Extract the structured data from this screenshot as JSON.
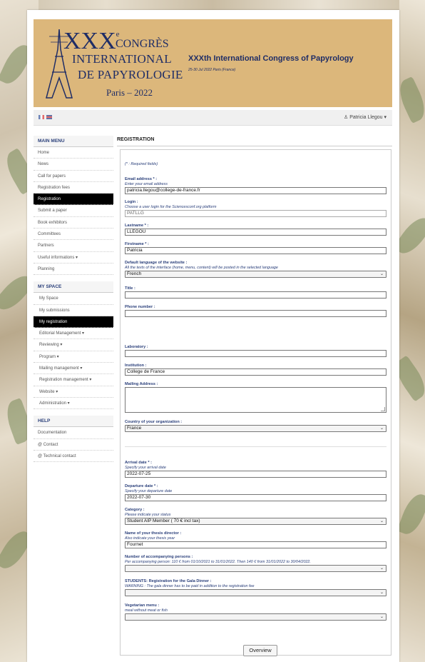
{
  "banner": {
    "logo_xxx": "XXX",
    "logo_sup": "e",
    "logo_congres": "CONGRÈS",
    "logo_international": "INTERNATIONAL",
    "logo_papyrologie": "DE PAPYROLOGIE",
    "logo_paris": "Paris – 2022",
    "title": "XXXth International Congress of Papyrology",
    "dates": "25-30 Jul 2022 Paris (France)"
  },
  "userbar": {
    "user_name": "Patricia Llegou",
    "user_icon": "user-icon"
  },
  "sidebar": {
    "main_menu_title": "MAIN MENU",
    "main_menu": [
      "Home",
      "News",
      "Call for papers",
      "Registration fees",
      "Registration",
      "Submit a paper",
      "Book exhibitors",
      "Committees",
      "Partners",
      "Useful informations ▾",
      "Planning"
    ],
    "main_menu_active": 4,
    "my_space_title": "MY SPACE",
    "my_space": [
      "My Space",
      "My submissions",
      "My registration",
      "Editorial Management ▾",
      "Reviewing ▾",
      "Program ▾",
      "Mailing management ▾",
      "Registration management ▾",
      "Website ▾",
      "Administration ▾"
    ],
    "my_space_active": 2,
    "help_title": "HELP",
    "help": [
      "Documentation",
      "@ Contact",
      "@ Technical contact"
    ]
  },
  "content": {
    "title": "REGISTRATION",
    "required_note": "(* : Required fields)",
    "email": {
      "label": "Email address * :",
      "hint": "Enter your email address",
      "value": "patricia.llegou@college-de-france.fr"
    },
    "login": {
      "label": "Login :",
      "hint": "Choose a user login for the Sciencesconf.org platform",
      "value": "PATLLG"
    },
    "lastname": {
      "label": "Lastname * :",
      "value": "LLEGOU"
    },
    "firstname": {
      "label": "Firstname * :",
      "value": "Patricia"
    },
    "language": {
      "label": "Default language of the website :",
      "hint": "All the texts of the interface (home, menu, content) will be posted in the selected language",
      "value": "French"
    },
    "title_field": {
      "label": "Title :",
      "value": ""
    },
    "phone": {
      "label": "Phone number :",
      "value": ""
    },
    "laboratory": {
      "label": "Laboratory :",
      "value": ""
    },
    "institution": {
      "label": "Institution :",
      "value": "College de France"
    },
    "mailing": {
      "label": "Mailing Address :",
      "value": ""
    },
    "country": {
      "label": "Country of your organization :",
      "value": "France"
    },
    "arrival": {
      "label": "Arrival date * :",
      "hint": "Specify your arrival date",
      "value": "2022-07-25"
    },
    "departure": {
      "label": "Departure date * :",
      "hint": "Specify your departure date",
      "value": "2022-07-30"
    },
    "category": {
      "label": "Category :",
      "hint": "Please indicate your status",
      "value": "Student AIP Member ( 70 € incl tax)"
    },
    "thesis": {
      "label": "Name of your thesis director :",
      "hint": "Also indicate your thesis year",
      "value": "Fournet"
    },
    "accompanying": {
      "label": "Number of accompanying persons :",
      "hint": "Per accompanying person: 110 € from 01/10/2021 to 31/01/2022. Then 140 € from 31/01/2022 to 30/04/2022.",
      "value": ""
    },
    "gala": {
      "label": "STUDENTS: Registration for the Gala Dinner :",
      "hint": "WARNING : The gala dinner has to be paid in addition to the registration fee",
      "value": ""
    },
    "vegetarian": {
      "label": "Vegetarian menu :",
      "hint": "meal without meat or fish",
      "value": ""
    },
    "overview_button": "Overview"
  }
}
